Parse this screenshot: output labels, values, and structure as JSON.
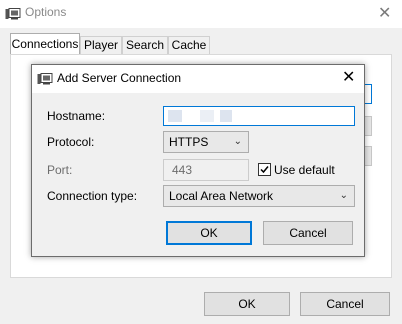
{
  "window": {
    "title": "Options",
    "close_glyph": "✕",
    "tabs": [
      {
        "label": "Connections",
        "active": true
      },
      {
        "label": "Player",
        "active": false
      },
      {
        "label": "Search",
        "active": false
      },
      {
        "label": "Cache",
        "active": false
      }
    ],
    "ok_label": "OK",
    "cancel_label": "Cancel",
    "app_icon": "app-server-icon"
  },
  "dialog": {
    "title": "Add Server Connection",
    "close_glyph": "✕",
    "fields": {
      "hostname": {
        "label": "Hostname:",
        "value": ""
      },
      "protocol": {
        "label": "Protocol:",
        "value": "HTTPS"
      },
      "port": {
        "label": "Port:",
        "value": "443"
      },
      "use_default": {
        "label": "Use default",
        "checked": true
      },
      "connection_type": {
        "label": "Connection type:",
        "value": "Local Area Network"
      }
    },
    "ok_label": "OK",
    "cancel_label": "Cancel"
  },
  "colors": {
    "accent": "#0078d7",
    "window_bg": "#f0f0f0",
    "button_bg": "#e1e1e1"
  }
}
